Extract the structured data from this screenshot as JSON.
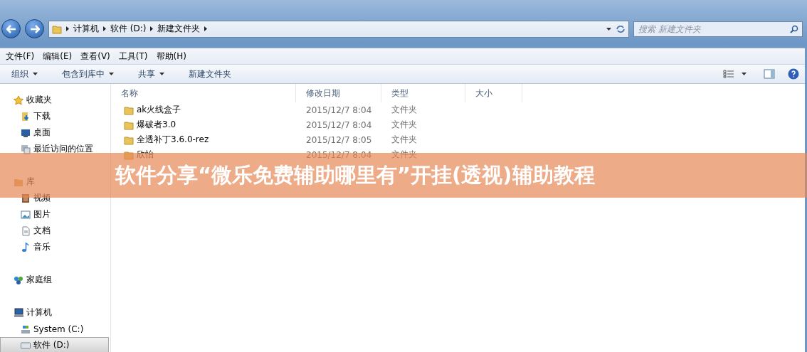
{
  "address_bar": {
    "crumbs": [
      "计算机",
      "软件 (D:)",
      "新建文件夹"
    ]
  },
  "search": {
    "placeholder": "搜索 新建文件夹"
  },
  "menu": [
    "文件(F)",
    "编辑(E)",
    "查看(V)",
    "工具(T)",
    "帮助(H)"
  ],
  "toolbar": [
    {
      "label": "组织",
      "kind": "menu"
    },
    {
      "label": "包含到库中",
      "kind": "menu"
    },
    {
      "label": "共享",
      "kind": "menu"
    },
    {
      "label": "新建文件夹",
      "kind": "button"
    }
  ],
  "sidebar": [
    {
      "label": "收藏夹",
      "selected": false,
      "children": [
        {
          "label": "下载",
          "selected": false
        },
        {
          "label": "桌面",
          "selected": false
        },
        {
          "label": "最近访问的位置",
          "selected": false
        }
      ]
    },
    {
      "label": "库",
      "selected": false,
      "children": [
        {
          "label": "视频",
          "selected": false
        },
        {
          "label": "图片",
          "selected": false
        },
        {
          "label": "文档",
          "selected": false
        },
        {
          "label": "音乐",
          "selected": false
        }
      ]
    },
    {
      "label": "家庭组",
      "selected": false
    },
    {
      "label": "计算机",
      "selected": false,
      "children": [
        {
          "label": "System (C:)",
          "selected": false
        },
        {
          "label": "软件 (D:)",
          "selected": true
        }
      ]
    }
  ],
  "table": {
    "columns": [
      "名称",
      "修改日期",
      "类型",
      "大小"
    ],
    "rows": [
      {
        "name": "ak火线盒子",
        "date": "2015/12/7 8:04",
        "type": "文件夹"
      },
      {
        "name": "爆破者3.0",
        "date": "2015/12/7 8:04",
        "type": "文件夹"
      },
      {
        "name": "全透补丁3.6.0-rez",
        "date": "2015/12/7 8:05",
        "type": "文件夹"
      },
      {
        "name": "欣怡",
        "date": "2015/12/7 8:04",
        "type": "文件夹"
      }
    ]
  },
  "banner": {
    "text": "软件分享“微乐免费辅助哪里有”开挂(透视)辅助教程"
  }
}
